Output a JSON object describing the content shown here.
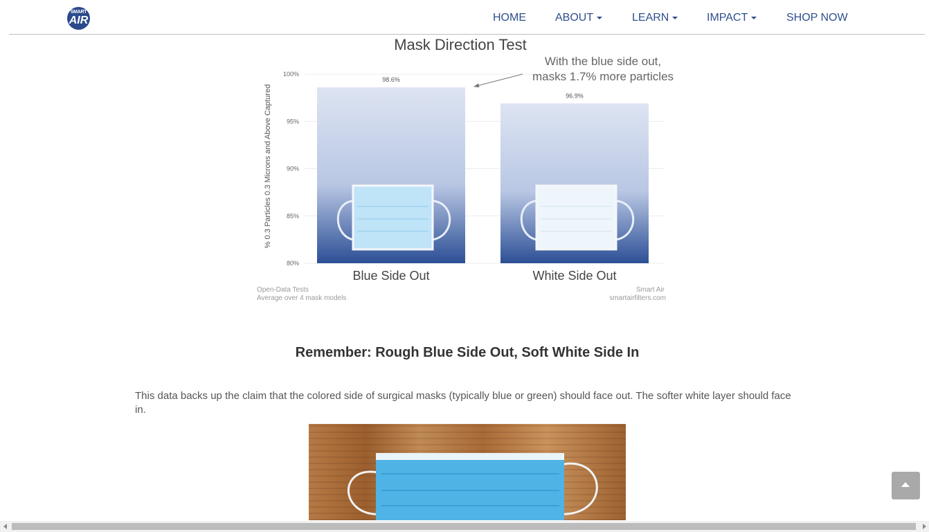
{
  "header": {
    "logo_top": "SMART",
    "logo_bottom": "AIR",
    "nav": [
      {
        "label": "HOME",
        "dropdown": false
      },
      {
        "label": "ABOUT",
        "dropdown": true
      },
      {
        "label": "LEARN",
        "dropdown": true
      },
      {
        "label": "IMPACT",
        "dropdown": true
      },
      {
        "label": "SHOP NOW",
        "dropdown": false
      }
    ]
  },
  "chart_data": {
    "type": "bar",
    "title": "Mask Direction Test",
    "ylabel": "% 0.3 Particles 0.3 Microns and Above Captured",
    "categories": [
      "Blue Side Out",
      "White Side Out"
    ],
    "values": [
      98.6,
      96.9
    ],
    "value_labels": [
      "98.6%",
      "96.9%"
    ],
    "ylim": [
      80,
      100
    ],
    "yticks": [
      80,
      85,
      90,
      95,
      100
    ],
    "ytick_labels": [
      "80%",
      "85%",
      "90%",
      "95%",
      "100%"
    ],
    "annotation_line1": "With the blue side out,",
    "annotation_line2": "masks 1.7% more particles",
    "footer_left_1": "Open-Data Tests",
    "footer_left_2": "Average over 4 mask models",
    "footer_right_1": "Smart Air",
    "footer_right_2": "smartairfilters.com",
    "bar_color_top": "#dde4f2",
    "bar_color_bottom": "#2c4f95",
    "grid": true
  },
  "content": {
    "heading": "Remember: Rough Blue Side Out, Soft White Side In",
    "paragraph": "This data backs up the claim that the colored side of surgical masks (typically blue or green) should face out.  The softer white layer should face in."
  }
}
